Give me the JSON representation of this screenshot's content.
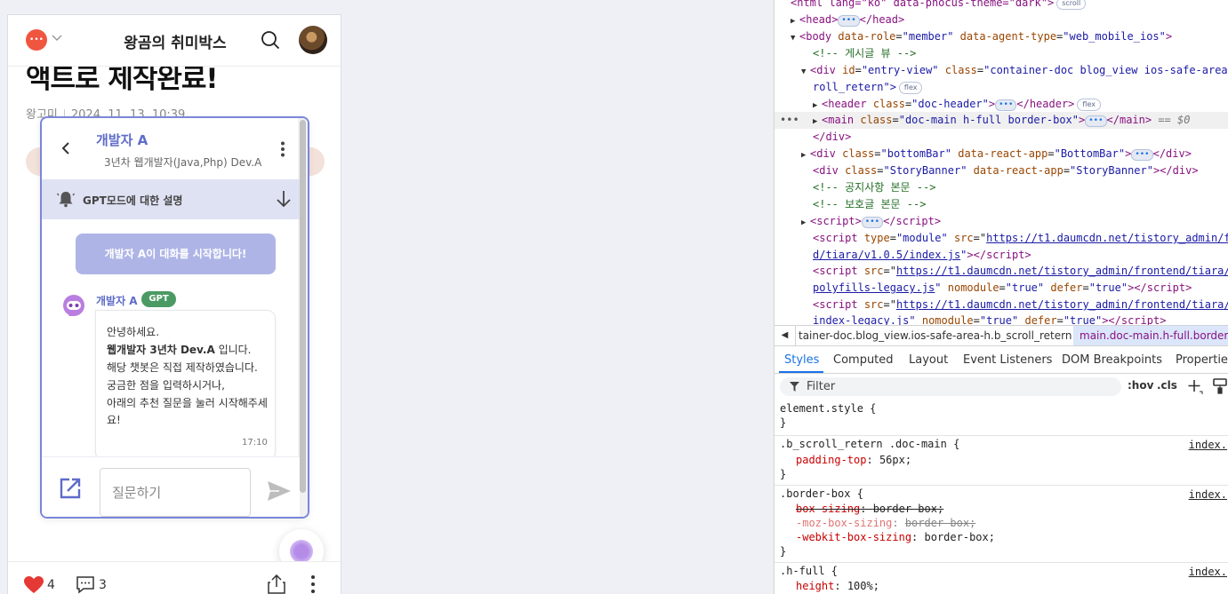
{
  "blog": {
    "title": "왕곰의 취미박스",
    "post_title": "액트로 제작완료!",
    "author": "왕고미",
    "date": "2024. 11. 13. 10:39",
    "like_count": "4",
    "comment_count": "3"
  },
  "chat": {
    "name": "개발자 A",
    "subtitle": "3년차 웹개발자(Java,Php) Dev.A",
    "gpt_banner": "GPT모드에 대한 설명",
    "start_button": "개발자 A이 대화를 시작합니다!",
    "bot_name": "개발자 A",
    "badge": "GPT",
    "message": {
      "line1": "안녕하세요.",
      "line2_bold": "웹개발자 3년차 Dev.A",
      "line2_rest": " 입니다.",
      "line3": "해당 챗봇은 직접 제작하였습니다.",
      "line4": "궁금한 점을 입력하시거나,",
      "line5": "아래의 추천 질문을 눌러 시작해주세",
      "line6": "요!",
      "time": "17:10"
    },
    "input_placeholder": "질문하기"
  },
  "devtools": {
    "dom_lines": {
      "l0_a": "<html lang=\"ko\" data-phocus-theme=\"dark\">",
      "l0_chip": "scroll",
      "l1": "head",
      "l2_tag": "body",
      "l2_attr1": "data-role",
      "l2_val1": "\"member\"",
      "l2_attr2": "data-agent-type",
      "l2_val2": "\"web_mobile_ios\"",
      "l3": "<!-- 게시글 뷰 -->",
      "l4_a": "id",
      "l4_v": "\"entry-view\"",
      "l4_c": "class",
      "l4_cv": "\"container-doc blog_view ios-safe-area-h b_sc",
      "l5": "roll_retern\">",
      "l5_chip": "flex",
      "l6_v": "\"doc-header\"",
      "l6_chip": "flex",
      "l7_v": "\"doc-main h-full border-box\"",
      "l7_eq": "== $0",
      "l8": "</div>",
      "l9_v1": "\"bottomBar\"",
      "l9_a2": "data-react-app",
      "l9_v2": "\"BottomBar\"",
      "l10_v1": "\"StoryBanner\"",
      "l10_v2": "\"StoryBanner\"",
      "l11": "<!-- 공지사항 본문 -->",
      "l12": "<!-- 보호글 본문 -->",
      "l14_type": "\"module\"",
      "l14_src": "https://t1.daumcdn.net/tistory_admin/fron",
      "l15_src": "d/tiara/v1.0.5/index.js",
      "l16_src": "https://t1.daumcdn.net/tistory_admin/frontend/tiara/v1",
      "l17_src": "polyfills-legacy.js",
      "l17_rest": "\"true\"",
      "l18_src": "https://t1.daumcdn.net/tistory_admin/frontend/tiara/v1",
      "l19_src": "index-legacy.js"
    },
    "breadcrumb": {
      "left": "tainer-doc.blog_view.ios-safe-area-h.b_scroll_retern",
      "selected": "main.doc-main.h-full.border-box"
    },
    "tabs": [
      "Styles",
      "Computed",
      "Layout",
      "Event Listeners",
      "DOM Breakpoints",
      "Properties"
    ],
    "filter_placeholder": "Filter",
    "hov": ":hov",
    "cls": ".cls",
    "rules": {
      "r1_sel": "element.style {",
      "r2_sel": ".b_scroll_retern .doc-main {",
      "r2_prop": "padding-top",
      "r2_val": "56px;",
      "r3_sel": ".border-box {",
      "r3_p1": "box-sizing",
      "r3_v1": "border-box;",
      "r3_p2": "-moz-box-sizing",
      "r3_v2": "border-box;",
      "r3_p3": "-webkit-box-sizing",
      "r3_v3": "border-box;",
      "r4_sel": ".h-full {",
      "r4_prop": "height",
      "r4_val": "100%;",
      "src": "index.",
      "close": "}"
    }
  }
}
